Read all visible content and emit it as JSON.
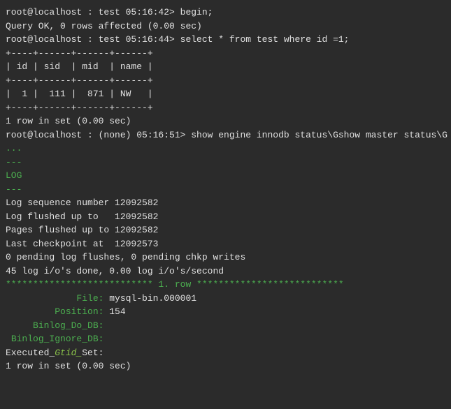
{
  "lines": [
    {
      "text": "root@localhost : test 05:16:42> begin;",
      "class": "prompt"
    },
    {
      "text": "Query OK, 0 rows affected (0.00 sec)",
      "class": "white"
    },
    {
      "text": "",
      "class": ""
    },
    {
      "text": "root@localhost : test 05:16:44> select * from test where id =1;",
      "class": "prompt"
    },
    {
      "text": "+----+------+------+------+",
      "class": "white"
    },
    {
      "text": "| id | sid  | mid  | name |",
      "class": "white"
    },
    {
      "text": "+----+------+------+------+",
      "class": "white"
    },
    {
      "text": "|  1 |  111 |  871 | NW   |",
      "class": "white"
    },
    {
      "text": "+----+------+------+------+",
      "class": "white"
    },
    {
      "text": "1 row in set (0.00 sec)",
      "class": "white"
    },
    {
      "text": "",
      "class": ""
    },
    {
      "text": "root@localhost : (none) 05:16:51> show engine innodb status\\Gshow master status\\G",
      "class": "prompt"
    },
    {
      "text": "...",
      "class": "green"
    },
    {
      "text": "---",
      "class": "green"
    },
    {
      "text": "LOG",
      "class": "green"
    },
    {
      "text": "---",
      "class": "green"
    },
    {
      "text": "Log sequence number 12092582",
      "class": "white"
    },
    {
      "text": "Log flushed up to   12092582",
      "class": "white"
    },
    {
      "text": "Pages flushed up to 12092582",
      "class": "white"
    },
    {
      "text": "Last checkpoint at  12092573",
      "class": "white"
    },
    {
      "text": "0 pending log flushes, 0 pending chkp writes",
      "class": "white"
    },
    {
      "text": "45 log i/o's done, 0.00 log i/o's/second",
      "class": "white"
    },
    {
      "text": "",
      "class": ""
    }
  ],
  "row_sep": "*************************** 1. row ***************************",
  "master_status": {
    "file_label": "File:",
    "file_value": "mysql-bin.000001",
    "position_label": "Position:",
    "position_value": "154",
    "binlog_do_db_label": "Binlog_Do_DB:",
    "binlog_ignore_db_label": "Binlog_Ignore_DB:",
    "executed_prefix": "Executed_",
    "executed_gtid": "Gtid_",
    "executed_suffix": "Set:"
  },
  "footer": "1 row in set (0.00 sec)"
}
